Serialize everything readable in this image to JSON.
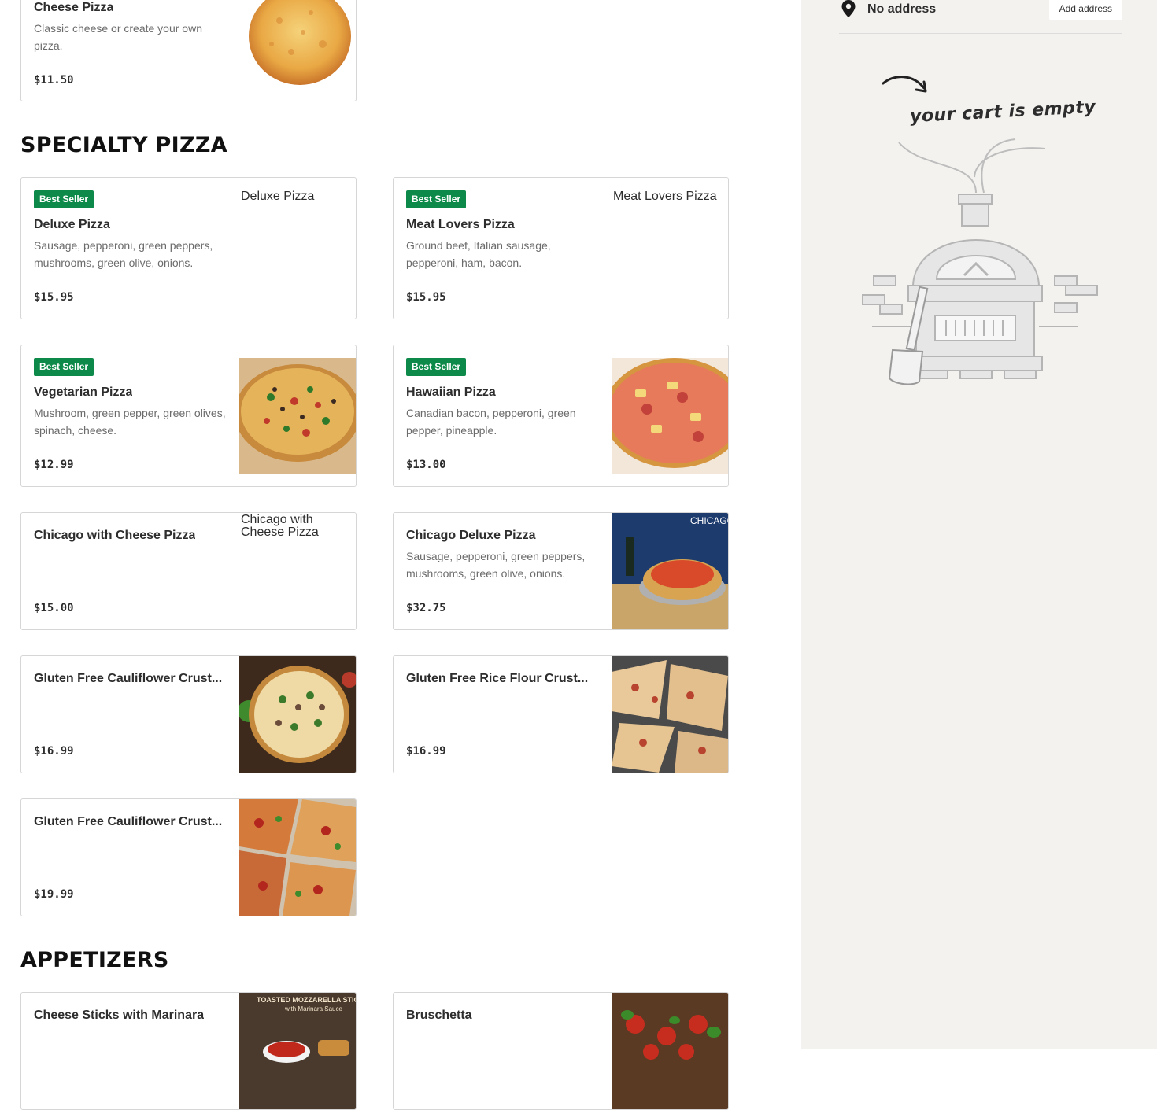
{
  "menu": {
    "top_item": {
      "name": "Cheese Pizza",
      "description": "Classic cheese or create your own pizza.",
      "price": "$11.50",
      "image_alt": ""
    },
    "sections": [
      {
        "title": "SPECIALTY PIZZA",
        "items": [
          {
            "badge": "Best Seller",
            "name": "Deluxe Pizza",
            "description": "Sausage, pepperoni, green peppers, mushrooms, green olive, onions.",
            "price": "$15.95",
            "image_alt": "Deluxe Pizza"
          },
          {
            "badge": "Best Seller",
            "name": "Meat Lovers Pizza",
            "description": "Ground beef, Italian sausage, pepperoni, ham, bacon.",
            "price": "$15.95",
            "image_alt": "Meat Lovers Pizza"
          },
          {
            "badge": "Best Seller",
            "name": "Vegetarian Pizza",
            "description": "Mushroom, green pepper, green olives, spinach, cheese.",
            "price": "$12.99"
          },
          {
            "badge": "Best Seller",
            "name": "Hawaiian Pizza",
            "description": "Canadian bacon, pepperoni, green pepper, pineapple.",
            "price": "$13.00"
          },
          {
            "name": "Chicago with Cheese Pizza",
            "description": "",
            "price": "$15.00",
            "image_alt": "Chicago with Cheese Pizza"
          },
          {
            "name": "Chicago Deluxe Pizza",
            "description": "Sausage, pepperoni, green peppers, mushrooms, green olive, onions.",
            "price": "$32.75",
            "image_text": "CHICAGO"
          },
          {
            "name": "Gluten Free Cauliflower Crust...",
            "price": "$16.99"
          },
          {
            "name": "Gluten Free Rice Flour Crust...",
            "price": "$16.99"
          },
          {
            "name": "Gluten Free Cauliflower Crust...",
            "price": "$19.99"
          }
        ]
      },
      {
        "title": "APPETIZERS",
        "items": [
          {
            "name": "Cheese Sticks with Marinara",
            "image_text_1": "TOASTED MOZZARELLA STICKS",
            "image_text_2": "with Marinara Sauce"
          },
          {
            "name": "Bruschetta"
          }
        ]
      }
    ]
  },
  "cart": {
    "address_icon": "location-pin-icon",
    "address_text": "No address",
    "add_address_label": "Add address",
    "empty_message": "your cart is empty",
    "illustration": "pizza-oven-illustration"
  },
  "colors": {
    "badge": "#0d8a4a",
    "sidebar_bg": "#f3f2ef",
    "border": "#d6d6d6"
  }
}
